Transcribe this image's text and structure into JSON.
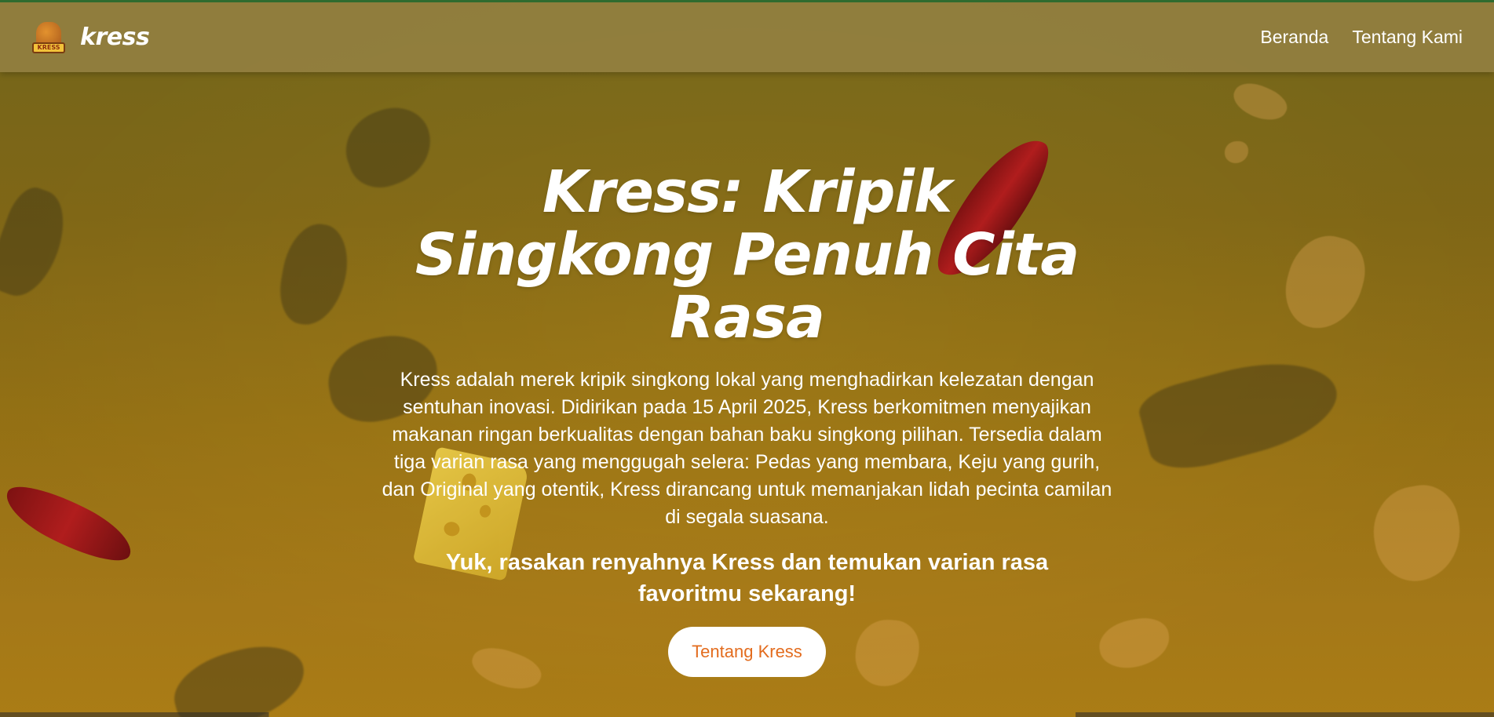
{
  "nav": {
    "logo_badge": "KRESS",
    "brand": "kress",
    "links": [
      "Beranda",
      "Tentang Kami"
    ]
  },
  "hero": {
    "title": "Kress: Kripik Singkong Penuh Cita Rasa",
    "description": "Kress adalah merek kripik singkong lokal yang menghadirkan kelezatan dengan sentuhan inovasi. Didirikan pada 15 April 2025, Kress berkomitmen menyajikan makanan ringan berkualitas dengan bahan baku singkong pilihan. Tersedia dalam tiga varian rasa yang menggugah selera: Pedas yang membara, Keju yang gurih, dan Original yang otentik, Kress dirancang untuk memanjakan lidah pecinta camilan di segala suasana.",
    "cta_text": "Yuk, rasakan renyahnya Kress dan temukan varian rasa favoritmu sekarang!",
    "button_label": "Tentang Kress"
  },
  "colors": {
    "accent": "#e36c1e",
    "navbar_bg": "#968246",
    "hero_bg": "#a17a16",
    "top_border": "#2f6b2f"
  }
}
